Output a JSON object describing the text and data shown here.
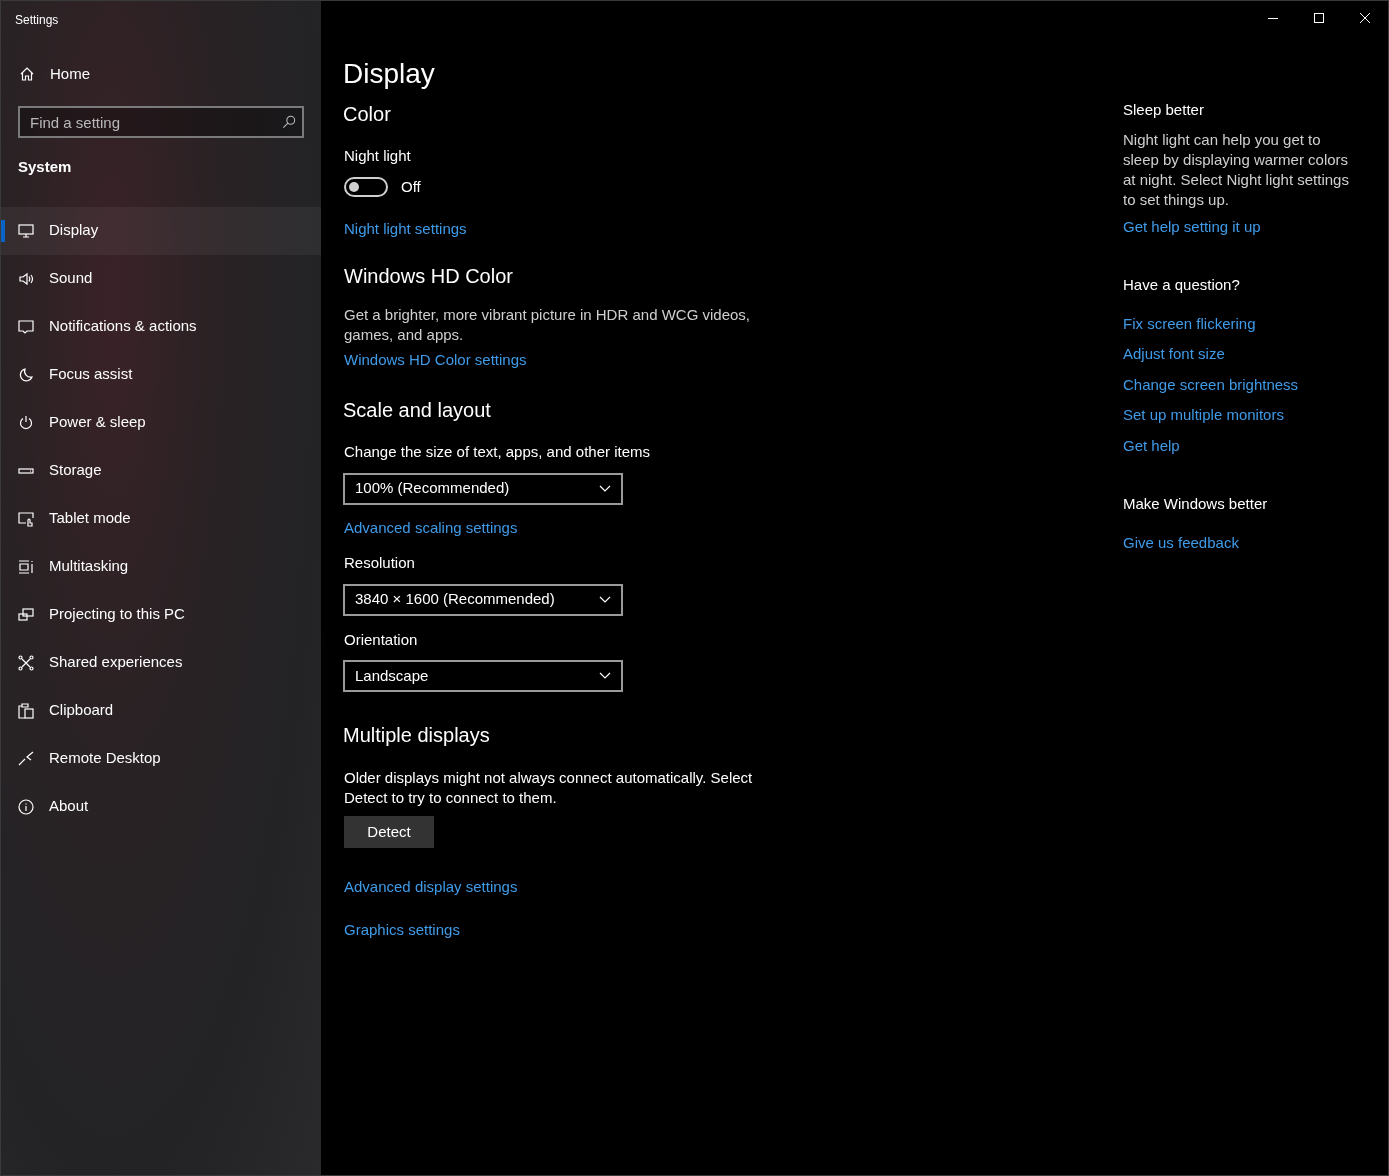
{
  "window": {
    "title": "Settings"
  },
  "sidebar": {
    "home": "Home",
    "search": {
      "placeholder": "Find a setting"
    },
    "section": "System",
    "items": [
      {
        "label": "Display",
        "selected": true
      },
      {
        "label": "Sound",
        "selected": false
      },
      {
        "label": "Notifications & actions",
        "selected": false
      },
      {
        "label": "Focus assist",
        "selected": false
      },
      {
        "label": "Power & sleep",
        "selected": false
      },
      {
        "label": "Storage",
        "selected": false
      },
      {
        "label": "Tablet mode",
        "selected": false
      },
      {
        "label": "Multitasking",
        "selected": false
      },
      {
        "label": "Projecting to this PC",
        "selected": false
      },
      {
        "label": "Shared experiences",
        "selected": false
      },
      {
        "label": "Clipboard",
        "selected": false
      },
      {
        "label": "Remote Desktop",
        "selected": false
      },
      {
        "label": "About",
        "selected": false
      }
    ]
  },
  "page": {
    "title": "Display",
    "color": {
      "heading": "Color",
      "night_light": {
        "label": "Night light",
        "on": false,
        "state_text": "Off"
      },
      "link": "Night light settings"
    },
    "hd_color": {
      "heading": "Windows HD Color",
      "description": "Get a brighter, more vibrant picture in HDR and WCG videos, games, and apps.",
      "link": "Windows HD Color settings"
    },
    "scale": {
      "heading": "Scale and layout",
      "fields": [
        {
          "label": "Change the size of text, apps, and other items",
          "value": "100% (Recommended)",
          "link": "Advanced scaling settings"
        },
        {
          "label": "Resolution",
          "value": "3840 × 1600 (Recommended)"
        },
        {
          "label": "Orientation",
          "value": "Landscape"
        }
      ]
    },
    "multiple": {
      "heading": "Multiple displays",
      "description": "Older displays might not always connect automatically. Select Detect to try to connect to them.",
      "button": "Detect",
      "links": [
        "Advanced display settings",
        "Graphics settings"
      ]
    }
  },
  "aside": [
    {
      "heading": "Sleep better",
      "text": "Night light can help you get to sleep by displaying warmer colors at night. Select Night light settings to set things up.",
      "links": [
        "Get help setting it up"
      ]
    },
    {
      "heading": "Have a question?",
      "links": [
        "Fix screen flickering",
        "Adjust font size",
        "Change screen brightness",
        "Set up multiple monitors",
        "Get help"
      ]
    },
    {
      "heading": "Make Windows better",
      "links": [
        "Give us feedback"
      ]
    }
  ]
}
